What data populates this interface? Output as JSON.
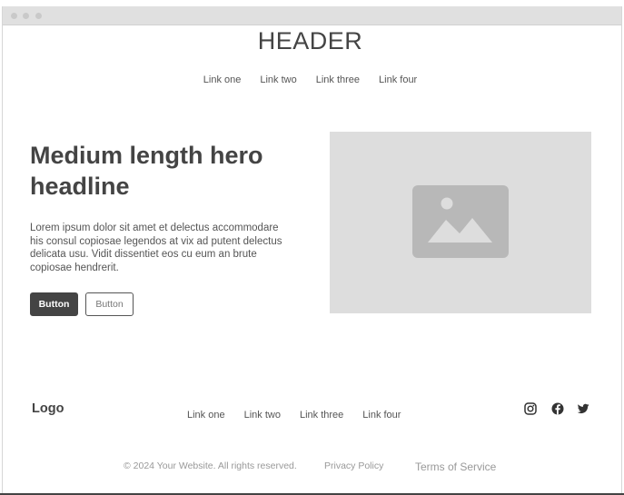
{
  "header": {
    "title": "HEADER"
  },
  "nav": {
    "links": [
      "Link one",
      "Link two",
      "Link three",
      "Link four"
    ]
  },
  "hero": {
    "headline": "Medium length hero headline",
    "body": "Lorem ipsum dolor sit amet et delectus accommodare his consul copiosae legendos at vix ad putent delectus delicata usu. Vidit dissentiet eos cu eum an brute copiosae hendrerit.",
    "primary_button": "Button",
    "secondary_button": "Button",
    "image_icon": "image-placeholder-icon"
  },
  "footer": {
    "logo": "Logo",
    "links": [
      "Link one",
      "Link two",
      "Link three",
      "Link four"
    ],
    "social_icons": [
      "instagram-icon",
      "facebook-icon",
      "twitter-icon"
    ],
    "copyright": "© 2024 Your Website. All rights reserved.",
    "privacy": "Privacy Policy",
    "terms": "Terms of Service"
  },
  "colors": {
    "text_dark": "#444444",
    "text_muted": "#999999",
    "placeholder_bg": "#dddddd",
    "placeholder_icon": "#b8b8b8",
    "primary_button_bg": "#444444"
  }
}
